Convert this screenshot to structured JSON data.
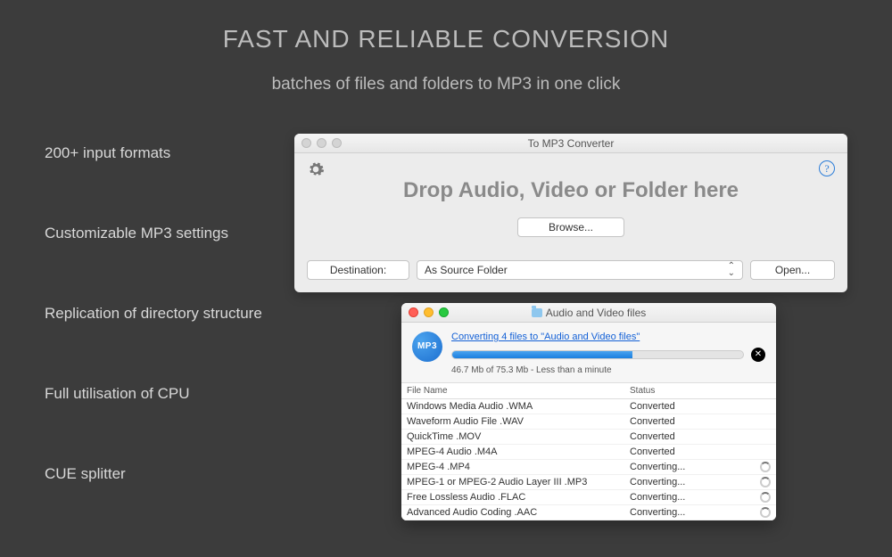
{
  "page": {
    "title": "FAST AND RELIABLE CONVERSION",
    "subtitle": "batches of files and folders to MP3 in one click"
  },
  "features": [
    "200+ input formats",
    "Customizable MP3 settings",
    "Replication of directory structure",
    "Full utilisation of CPU",
    "CUE splitter"
  ],
  "main_window": {
    "title": "To MP3 Converter",
    "drop_label": "Drop Audio, Video or Folder here",
    "browse_label": "Browse...",
    "destination_label": "Destination:",
    "destination_value": "As Source Folder",
    "open_label": "Open..."
  },
  "progress_window": {
    "title": "Audio and Video files",
    "badge": "MP3",
    "link": "Converting 4 files to \"Audio and Video files\"",
    "progress_percent": 62,
    "subtext": "46.7 Mb of 75.3 Mb - Less than a minute",
    "columns": {
      "name": "File Name",
      "status": "Status"
    },
    "rows": [
      {
        "name": "Windows Media Audio .WMA",
        "status": "Converted",
        "busy": false
      },
      {
        "name": "Waveform Audio File .WAV",
        "status": "Converted",
        "busy": false
      },
      {
        "name": "QuickTime .MOV",
        "status": "Converted",
        "busy": false
      },
      {
        "name": "MPEG-4 Audio .M4A",
        "status": "Converted",
        "busy": false
      },
      {
        "name": "MPEG-4 .MP4",
        "status": "Converting...",
        "busy": true
      },
      {
        "name": "MPEG-1 or MPEG-2 Audio Layer III .MP3",
        "status": "Converting...",
        "busy": true
      },
      {
        "name": "Free Lossless Audio .FLAC",
        "status": "Converting...",
        "busy": true
      },
      {
        "name": "Advanced Audio Coding .AAC",
        "status": "Converting...",
        "busy": true
      }
    ]
  }
}
